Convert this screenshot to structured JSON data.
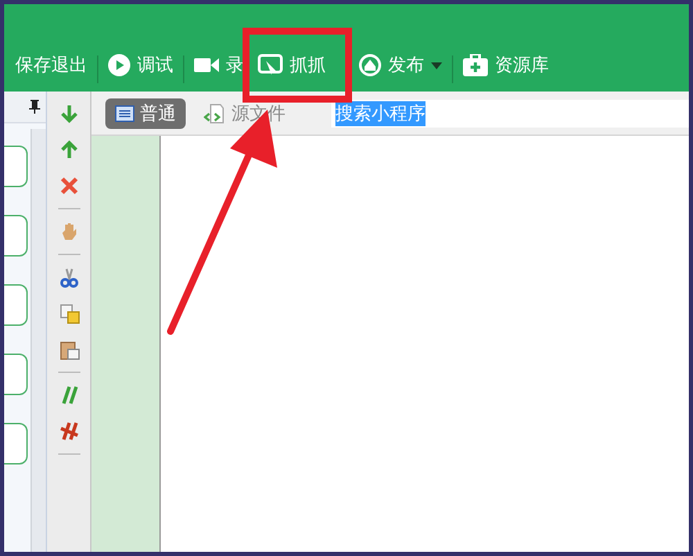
{
  "toolbar": {
    "items": [
      {
        "label": "保存退出",
        "kind": "none",
        "has_menu": false,
        "highlighted": false
      },
      {
        "kind": "separator"
      },
      {
        "label": "调试",
        "kind": "play",
        "has_menu": false,
        "highlighted": false
      },
      {
        "kind": "separator"
      },
      {
        "label": "录",
        "kind": "camera",
        "has_menu": false,
        "highlighted": false
      },
      {
        "label": "抓抓",
        "kind": "capture",
        "has_menu": false,
        "highlighted": true
      },
      {
        "label": "发布",
        "kind": "publish",
        "has_menu": true,
        "highlighted": false
      },
      {
        "kind": "separator"
      },
      {
        "label": "资源库",
        "kind": "library",
        "has_menu": false,
        "highlighted": false
      }
    ]
  },
  "side_tools": [
    {
      "kind": "down"
    },
    {
      "kind": "up"
    },
    {
      "kind": "delete"
    },
    {
      "kind": "sep"
    },
    {
      "kind": "hand"
    },
    {
      "kind": "sep"
    },
    {
      "kind": "cut"
    },
    {
      "kind": "copy"
    },
    {
      "kind": "paste"
    },
    {
      "kind": "sep"
    },
    {
      "kind": "comment"
    },
    {
      "kind": "uncomment"
    },
    {
      "kind": "sep"
    }
  ],
  "tabs": [
    {
      "label": "普通",
      "selected": true
    },
    {
      "label": "源文件",
      "selected": false
    }
  ],
  "address": {
    "value": "搜索小程序",
    "value_selected": true
  },
  "pointer_arrow": true
}
